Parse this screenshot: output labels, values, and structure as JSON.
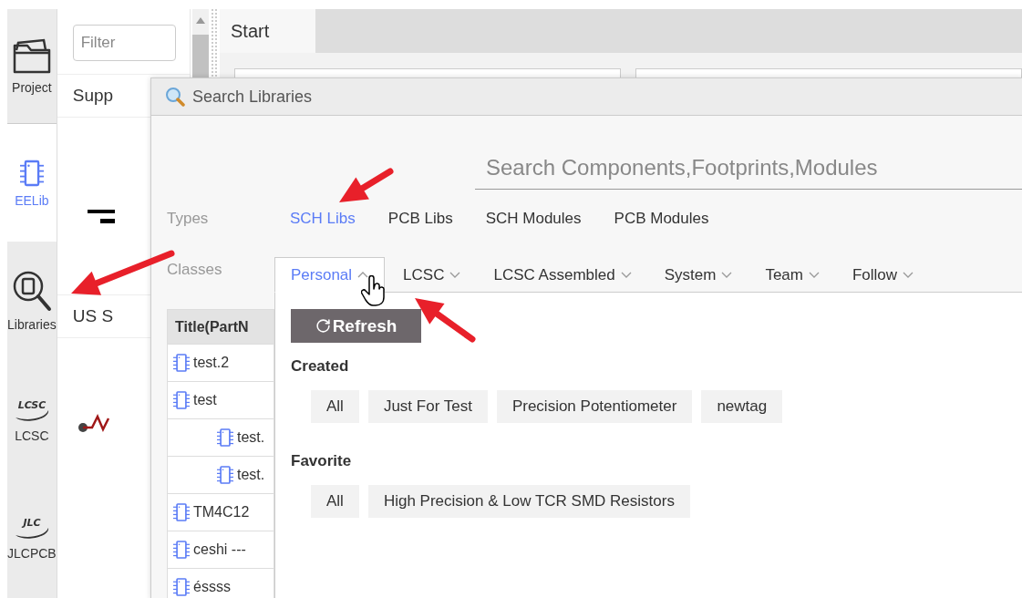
{
  "sidebar": {
    "items": [
      {
        "label": "Project",
        "kind": "folder",
        "selected": false
      },
      {
        "label": "EELib",
        "kind": "chip",
        "selected": true
      },
      {
        "label": "Libraries",
        "kind": "library",
        "selected": false
      },
      {
        "label": "LCSC",
        "kind": "logo",
        "logo_text": "LCSC",
        "selected": false
      },
      {
        "label": "JLCPCB",
        "kind": "logo",
        "logo_text": "JLC",
        "selected": false
      }
    ]
  },
  "panel": {
    "filter": {
      "placeholder": "Filter"
    },
    "rows": [
      "Supp",
      "US S"
    ]
  },
  "editor": {
    "tabs": [
      {
        "label": "Start",
        "selected": true
      }
    ]
  },
  "dialog": {
    "title": "Search Libraries",
    "search": {
      "placeholder": "Search Components,Footprints,Modules"
    },
    "types": {
      "label": "Types",
      "options": [
        {
          "label": "SCH Libs",
          "selected": true
        },
        {
          "label": "PCB Libs",
          "selected": false
        },
        {
          "label": "SCH Modules",
          "selected": false
        },
        {
          "label": "PCB Modules",
          "selected": false
        }
      ]
    },
    "classes": {
      "label": "Classes",
      "tabs": [
        {
          "label": "Personal",
          "selected": true,
          "expanded": true
        },
        {
          "label": "LCSC",
          "selected": false,
          "expanded": false
        },
        {
          "label": "LCSC Assembled",
          "selected": false,
          "expanded": false
        },
        {
          "label": "System",
          "selected": false,
          "expanded": false
        },
        {
          "label": "Team",
          "selected": false,
          "expanded": false
        },
        {
          "label": "Follow",
          "selected": false,
          "expanded": false
        }
      ]
    },
    "table": {
      "columns": [
        "Title(PartN"
      ],
      "rows": [
        {
          "title": "test.2"
        },
        {
          "title": "test",
          "children": [
            {
              "title": "test."
            },
            {
              "title": "test."
            }
          ]
        },
        {
          "title": "TM4C12"
        },
        {
          "title": "ceshi ---"
        },
        {
          "title": "éssss"
        }
      ]
    },
    "refresh_button": "Refresh",
    "groups": [
      {
        "heading": "Created",
        "tags": [
          "All",
          "Just For Test",
          "Precision Potentiometer",
          "newtag"
        ]
      },
      {
        "heading": "Favorite",
        "tags": [
          "All",
          "High Precision & Low TCR SMD Resistors"
        ]
      }
    ]
  }
}
